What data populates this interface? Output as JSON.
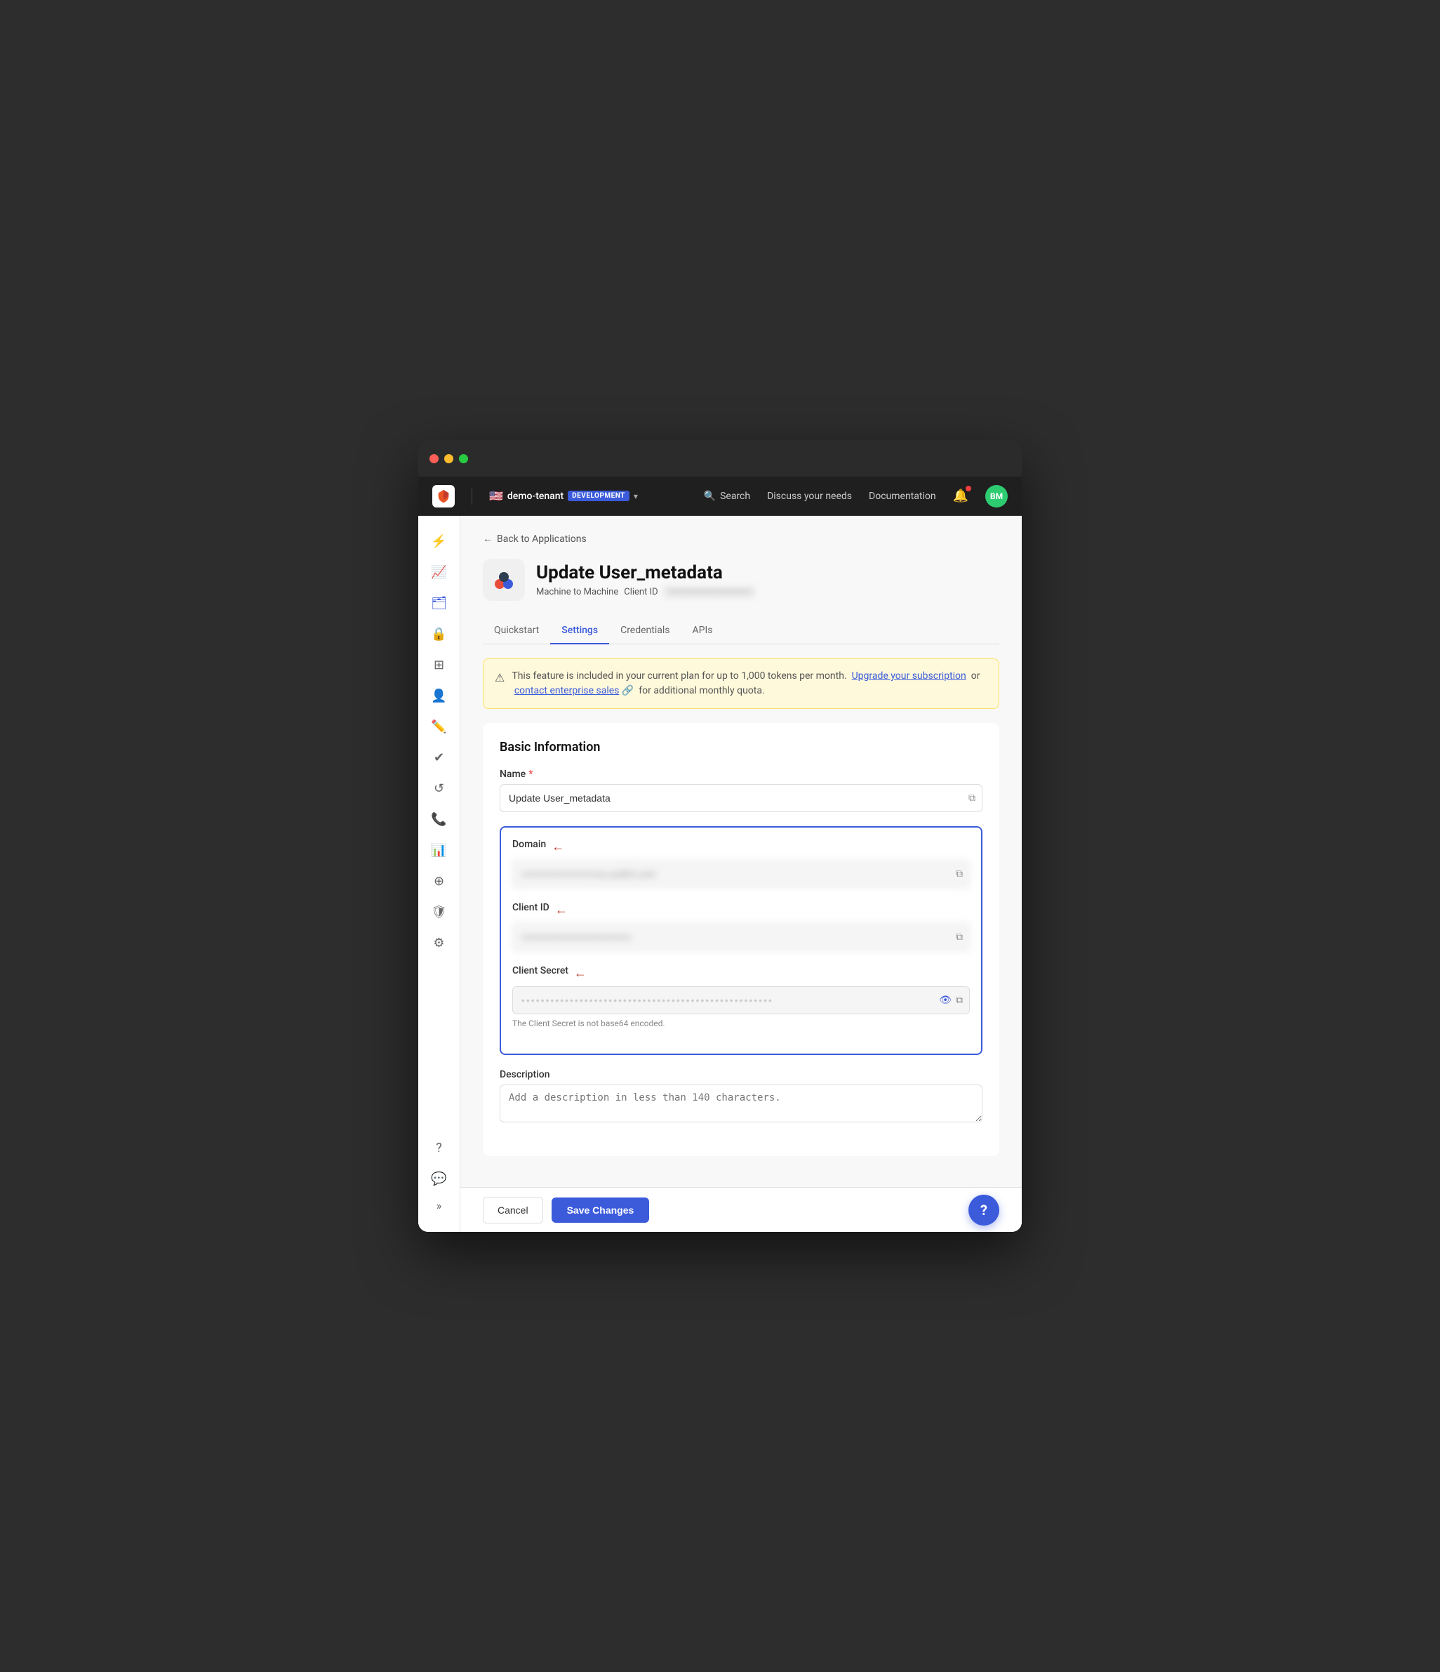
{
  "window": {
    "traffic_lights": [
      "red",
      "yellow",
      "green"
    ]
  },
  "topnav": {
    "logo_alt": "Auth0 logo",
    "flag": "🇺🇸",
    "tenant_name": "demo-tenant",
    "tenant_badge": "DEVELOPMENT",
    "chevron": "▾",
    "search_label": "Search",
    "discuss_label": "Discuss your needs",
    "docs_label": "Documentation",
    "avatar_initials": "BM"
  },
  "sidebar": {
    "items": [
      {
        "name": "lightning",
        "icon": "⚡",
        "active": false
      },
      {
        "name": "analytics",
        "icon": "📈",
        "active": false
      },
      {
        "name": "layers",
        "icon": "🗂",
        "active": true
      },
      {
        "name": "lock",
        "icon": "🔒",
        "active": false
      },
      {
        "name": "grid",
        "icon": "⊞",
        "active": false
      },
      {
        "name": "user",
        "icon": "👤",
        "active": false
      },
      {
        "name": "pencil",
        "icon": "✏️",
        "active": false
      },
      {
        "name": "check",
        "icon": "✔",
        "active": false
      },
      {
        "name": "refresh",
        "icon": "↺",
        "active": false
      },
      {
        "name": "phone",
        "icon": "📞",
        "active": false
      },
      {
        "name": "bar-chart",
        "icon": "📊",
        "active": false
      },
      {
        "name": "extension",
        "icon": "⊕",
        "active": false
      },
      {
        "name": "shield",
        "icon": "🛡",
        "active": false
      },
      {
        "name": "settings",
        "icon": "⚙",
        "active": false
      }
    ],
    "bottom_items": [
      {
        "name": "help",
        "icon": "?"
      },
      {
        "name": "chat",
        "icon": "💬"
      }
    ],
    "expand_label": "»"
  },
  "breadcrumb": {
    "back_label": "Back to Applications"
  },
  "app_header": {
    "title": "Update User_metadata",
    "type": "Machine to Machine",
    "client_id_label": "Client ID",
    "client_id_value": "••••••••••••••••••••••••••"
  },
  "tabs": [
    {
      "label": "Quickstart",
      "active": false
    },
    {
      "label": "Settings",
      "active": true
    },
    {
      "label": "Credentials",
      "active": false
    },
    {
      "label": "APIs",
      "active": false
    }
  ],
  "alert": {
    "icon": "⚠",
    "text_before": "This feature is included in your current plan for up to 1,000 tokens per month.",
    "link1_label": "Upgrade your subscription",
    "text_middle": "or",
    "link2_label": "contact enterprise sales",
    "text_after": "for additional monthly quota."
  },
  "basic_info": {
    "section_title": "Basic Information",
    "name_label": "Name",
    "name_required": true,
    "name_value": "Update User_metadata",
    "domain_label": "Domain",
    "domain_value": "••••••••••••••••••••••us.auth0.com",
    "client_id_label": "Client ID",
    "client_id_value": "••••••••••••••••••••••••••••••••",
    "client_secret_label": "Client Secret",
    "client_secret_value": "••••••••••••••••••••••••••••••••••••••••••••••••••••",
    "secret_hint": "The Client Secret is not base64 encoded.",
    "description_label": "Description",
    "description_placeholder": "Add a description in less than 140 characters."
  },
  "footer": {
    "cancel_label": "Cancel",
    "save_label": "Save Changes",
    "help_label": "?"
  }
}
